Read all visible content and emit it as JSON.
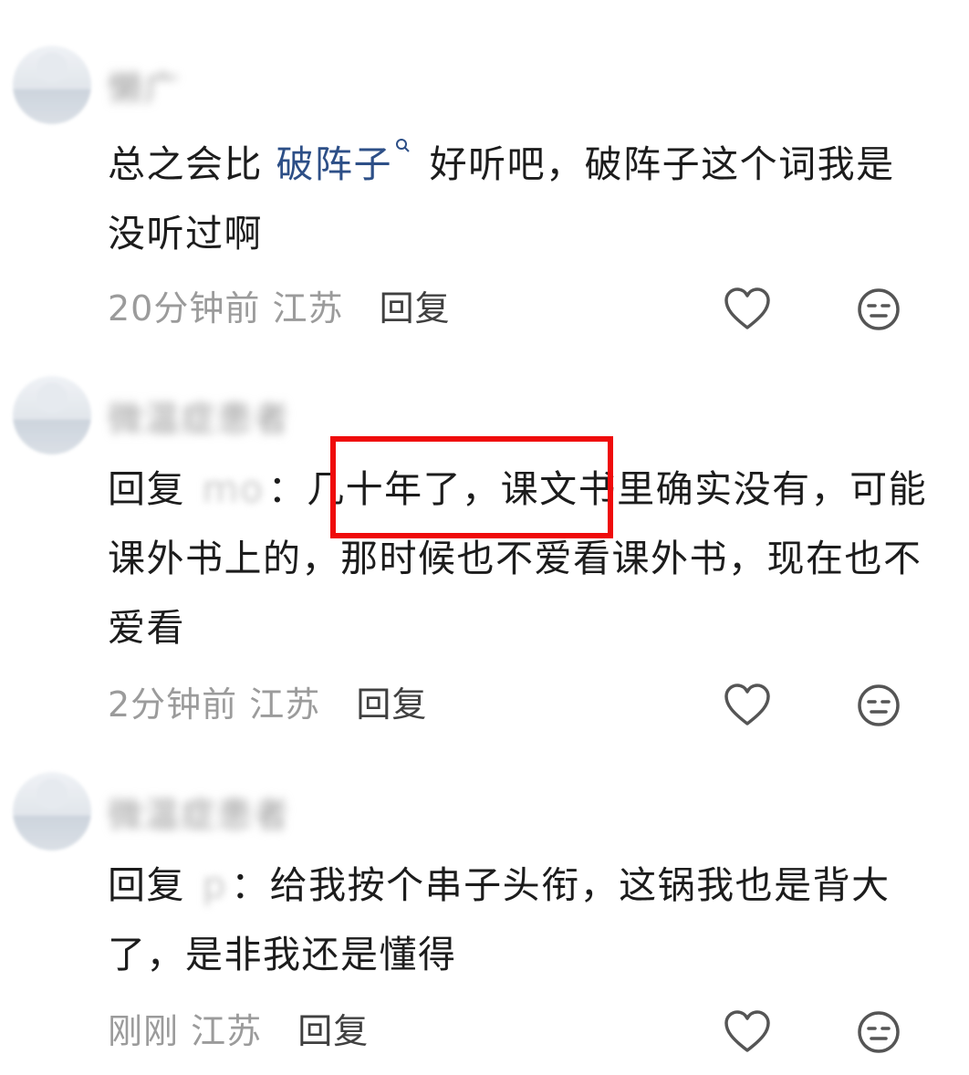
{
  "comments": [
    {
      "username": "懒广",
      "body": {
        "prefix": "总之会比 ",
        "keyword": "破阵子",
        "keyword_icon": "search-icon",
        "suffix": " 好听吧，破阵子这个词我是没听过啊"
      },
      "time": "20分钟前",
      "location": "江苏",
      "reply_label": "回复"
    },
    {
      "username": "微温症患者",
      "body": {
        "reply_prefix": "回复",
        "mention": "mo",
        "text": "：几十年了，课文书里确实没有，可能课外书上的，那时候也不爱看课外书，现在也不爱看"
      },
      "time": "2分钟前",
      "location": "江苏",
      "reply_label": "回复"
    },
    {
      "username": "微温症患者",
      "body": {
        "reply_prefix": "回复",
        "mention": "p",
        "text": "：给我按个串子头衔，这锅我也是背大了，是非我还是懂得"
      },
      "time": "刚刚",
      "location": "江苏",
      "reply_label": "回复"
    }
  ],
  "icons": {
    "like": "heart-icon",
    "emoji": "neutral-face-icon"
  },
  "colors": {
    "keyword": "#2d4f87",
    "highlight_box": "#ef0b0b",
    "meta_text": "#9b9b9b"
  }
}
